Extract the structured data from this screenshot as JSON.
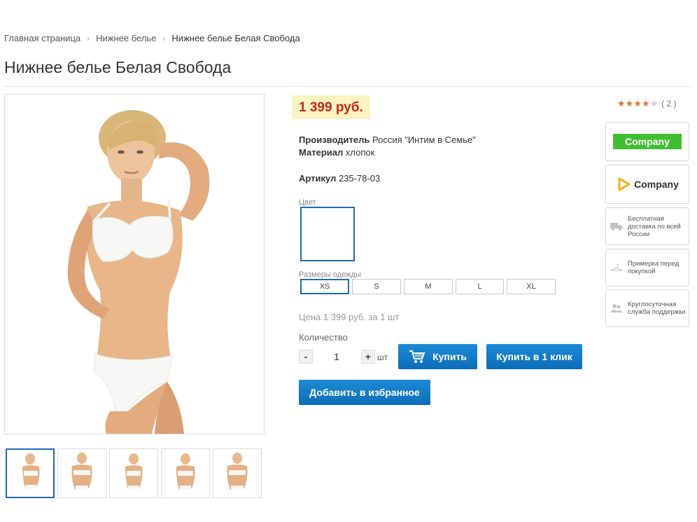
{
  "breadcrumb": {
    "home": "Главная страница",
    "category": "Нижнее белье",
    "current": "Нижнее белье Белая Свобода"
  },
  "product": {
    "title": "Нижнее белье Белая Свобода",
    "price": "1 399 руб.",
    "manufacturer_label": "Производитель",
    "manufacturer_value": "Россия \"Интим в Семье\"",
    "material_label": "Материал",
    "material_value": "хлопок",
    "article_label": "Артикул",
    "article_value": "235-78-03",
    "color_label": "Цвет",
    "sizes_label": "Размеры одежды",
    "sizes": [
      "XS",
      "S",
      "M",
      "L",
      "XL"
    ],
    "selected_size": "XS",
    "price_line": "Цена 1 399 руб. за 1 шт",
    "qty_label": "Количество",
    "qty_value": "1",
    "qty_minus": "-",
    "qty_plus": "+",
    "qty_unit": "шт",
    "buy_label": "Купить",
    "buy_one_click_label": "Купить в 1 клик",
    "favorite_label": "Добавить в избранное"
  },
  "rating": {
    "stars_filled": 4,
    "stars_total": 5,
    "count": "( 2 )",
    "star_color": "#e8741f"
  },
  "side": {
    "logo1": "Company",
    "logo2": "Company",
    "info": [
      {
        "icon": "truck-icon",
        "text": "Бесплатная доставка по всей России"
      },
      {
        "icon": "hanger-icon",
        "text": "Примерка перед покупкой"
      },
      {
        "icon": "users-icon",
        "text": "Круглосуточная служба поддержки"
      }
    ]
  },
  "thumbnails": {
    "count": 5,
    "active_index": 0
  },
  "colors": {
    "accent": "#1f6bb5",
    "button": "#0d6db7",
    "price": "#c22a1c",
    "price_bg": "#fbf3c1",
    "logo_green": "#3fbf2f"
  }
}
